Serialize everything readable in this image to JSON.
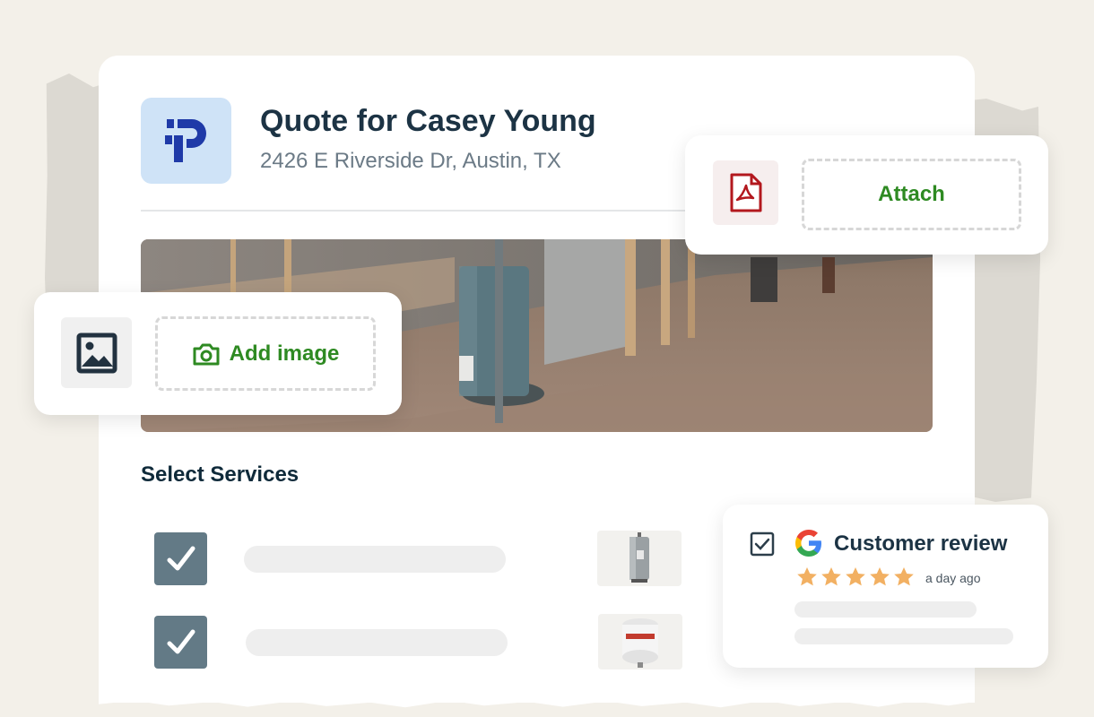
{
  "quote": {
    "title": "Quote for Casey Young",
    "address": "2426 E Riverside Dr, Austin, TX"
  },
  "attach_card": {
    "label": "Attach",
    "icon": "pdf-icon"
  },
  "image_card": {
    "label": "Add image",
    "icon": "image-icon",
    "button_icon": "camera-icon"
  },
  "services": {
    "title": "Select Services",
    "items": [
      {
        "checked": true,
        "thumb": "water-heater-thumbnail"
      },
      {
        "checked": true,
        "thumb": "expansion-tank-thumbnail"
      }
    ]
  },
  "review": {
    "title": "Customer review",
    "time": "a day ago",
    "rating": 5,
    "checked": true
  },
  "colors": {
    "accent_green": "#2e8a22",
    "logo_bg": "#cfe3f7",
    "logo_blue": "#1f3aa8",
    "star": "#f2b062",
    "pdf_red": "#b3181e"
  }
}
